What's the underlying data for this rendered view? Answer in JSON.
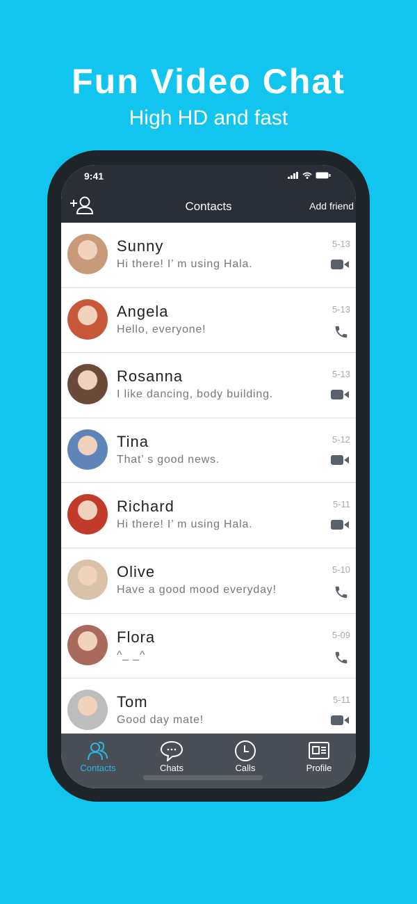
{
  "promo": {
    "title": "Fun Video Chat",
    "subtitle": "High HD and fast"
  },
  "status_bar": {
    "time": "9:41"
  },
  "header": {
    "title": "Contacts",
    "add_friend": "Add friend"
  },
  "contacts": [
    {
      "name": "Sunny",
      "message": "Hi there! I’ m using Hala.",
      "date": "5-13",
      "call_type": "video",
      "avatar_color": "#c99a7a"
    },
    {
      "name": "Angela",
      "message": "Hello, everyone!",
      "date": "5-13",
      "call_type": "phone",
      "avatar_color": "#c8583a"
    },
    {
      "name": "Rosanna",
      "message": "I like dancing, body building.",
      "date": "5-13",
      "call_type": "video",
      "avatar_color": "#6b4a3a"
    },
    {
      "name": "Tina",
      "message": "That’ s good news.",
      "date": "5-12",
      "call_type": "video",
      "avatar_color": "#5f84b8"
    },
    {
      "name": "Richard",
      "message": "Hi there! I’ m using Hala.",
      "date": "5-11",
      "call_type": "video",
      "avatar_color": "#c23a2a"
    },
    {
      "name": "Olive",
      "message": "Have a good mood everyday!",
      "date": "5-10",
      "call_type": "phone",
      "avatar_color": "#d8c2a8"
    },
    {
      "name": "Flora",
      "message": "^_ _^",
      "date": "5-09",
      "call_type": "phone",
      "avatar_color": "#a86a5a"
    },
    {
      "name": "Tom",
      "message": "Good day mate!",
      "date": "5-11",
      "call_type": "video",
      "avatar_color": "#bdbdbd"
    }
  ],
  "tabs": [
    {
      "label": "Contacts",
      "active": true
    },
    {
      "label": "Chats"
    },
    {
      "label": "Calls"
    },
    {
      "label": "Profile"
    }
  ],
  "colors": {
    "background": "#12c5ee",
    "accent": "#2bb8dc",
    "header": "#292e37",
    "tabbar": "#4a4f57"
  }
}
